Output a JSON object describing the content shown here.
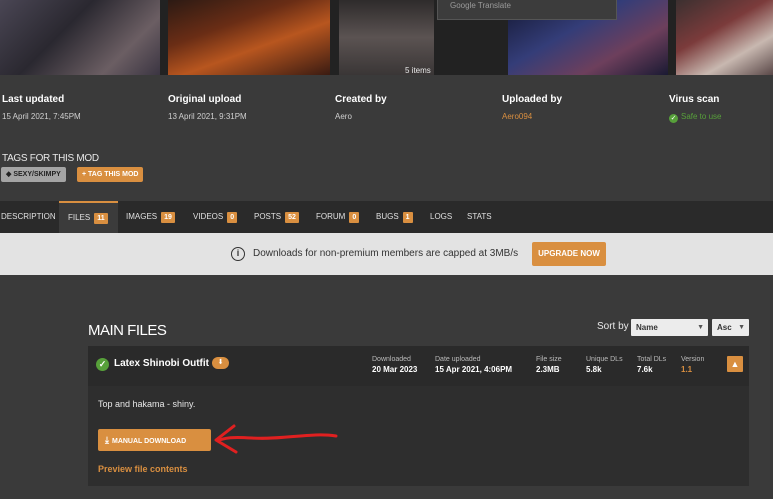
{
  "gallery": {
    "items_count": "5 items",
    "translate_popup": "Google Translate"
  },
  "stats": [
    {
      "label": "Last updated",
      "value": "15 April 2021,  7:45PM"
    },
    {
      "label": "Original upload",
      "value": "13 April 2021,  9:31PM"
    },
    {
      "label": "Created by",
      "value": "Aero"
    },
    {
      "label": "Uploaded by",
      "value": "Aero094"
    },
    {
      "label": "Virus scan",
      "value": "Safe to use"
    }
  ],
  "tags": {
    "title": "TAGS FOR THIS MOD",
    "items": [
      "SEXY/SKIMPY"
    ],
    "add_label": "TAG THIS MOD"
  },
  "tabs": [
    {
      "label": "DESCRIPTION",
      "badge": ""
    },
    {
      "label": "FILES",
      "badge": "11"
    },
    {
      "label": "IMAGES",
      "badge": "19"
    },
    {
      "label": "VIDEOS",
      "badge": "0"
    },
    {
      "label": "POSTS",
      "badge": "52"
    },
    {
      "label": "FORUM",
      "badge": "0"
    },
    {
      "label": "BUGS",
      "badge": "1"
    },
    {
      "label": "LOGS",
      "badge": ""
    },
    {
      "label": "STATS",
      "badge": ""
    }
  ],
  "notice": {
    "message": "Downloads for non-premium members are capped at 3MB/s",
    "button": "UPGRADE NOW"
  },
  "main_files": {
    "title": "MAIN FILES",
    "sort_label": "Sort by",
    "sort_field": "Name",
    "sort_order": "Asc",
    "file": {
      "name": "Latex Shinobi Outfit",
      "meta": [
        {
          "label": "Downloaded",
          "value": "20 Mar 2023"
        },
        {
          "label": "Date uploaded",
          "value": "15 Apr 2021, 4:06PM"
        },
        {
          "label": "File size",
          "value": "2.3MB"
        },
        {
          "label": "Unique DLs",
          "value": "5.8k"
        },
        {
          "label": "Total DLs",
          "value": "7.6k"
        },
        {
          "label": "Version",
          "value": "1.1"
        }
      ],
      "description": "Top and hakama - shiny.",
      "manual_download": "MANUAL DOWNLOAD",
      "preview": "Preview file contents"
    }
  },
  "colors": {
    "accent": "#d98f40",
    "success": "#57a03a",
    "annotation": "#e02020"
  }
}
